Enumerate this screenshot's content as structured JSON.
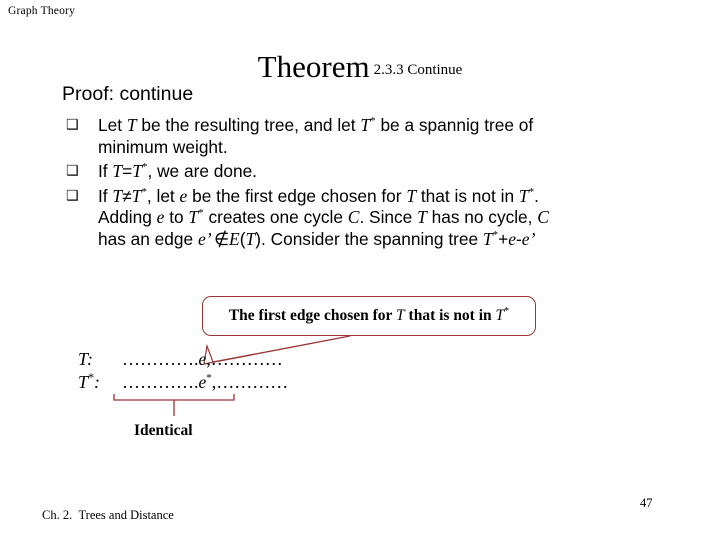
{
  "slide": {
    "header": "Graph Theory",
    "title": {
      "main": "Theorem",
      "sub": "2.3.3 Continue"
    },
    "proof_label": "Proof: continue",
    "bullet_glyph": "❑",
    "bullets": [
      {
        "id": "bullet-resulting-tree",
        "lines": [
          {
            "parts": [
              {
                "t": "text",
                "v": "Let "
              },
              {
                "t": "var",
                "v": "T"
              },
              {
                "t": "text",
                "v": " be the resulting tree, and let "
              },
              {
                "t": "var",
                "v": "T"
              },
              {
                "t": "sup",
                "v": "*"
              },
              {
                "t": "text",
                "v": " be a spannig tree of"
              }
            ]
          },
          {
            "parts": [
              {
                "t": "text",
                "v": "minimum weight."
              }
            ]
          }
        ]
      },
      {
        "id": "bullet-equal-case",
        "lines": [
          {
            "parts": [
              {
                "t": "text",
                "v": "If "
              },
              {
                "t": "var",
                "v": "T"
              },
              {
                "t": "varr",
                "v": "="
              },
              {
                "t": "var",
                "v": "T"
              },
              {
                "t": "sup",
                "v": "*"
              },
              {
                "t": "text",
                "v": ", we are done."
              }
            ]
          }
        ]
      },
      {
        "id": "bullet-not-equal-case",
        "lines": [
          {
            "parts": [
              {
                "t": "text",
                "v": "If "
              },
              {
                "t": "var",
                "v": "T"
              },
              {
                "t": "varr",
                "v": "≠"
              },
              {
                "t": "var",
                "v": "T"
              },
              {
                "t": "sup",
                "v": "*"
              },
              {
                "t": "text",
                "v": ", let "
              },
              {
                "t": "var",
                "v": "e"
              },
              {
                "t": "text",
                "v": " be the first edge chosen for "
              },
              {
                "t": "var",
                "v": "T"
              },
              {
                "t": "text",
                "v": " that is not in "
              },
              {
                "t": "var",
                "v": "T"
              },
              {
                "t": "sup",
                "v": "*"
              },
              {
                "t": "text",
                "v": "."
              }
            ]
          },
          {
            "parts": [
              {
                "t": "text",
                "v": "Adding "
              },
              {
                "t": "var",
                "v": "e"
              },
              {
                "t": "text",
                "v": " to "
              },
              {
                "t": "var",
                "v": "T"
              },
              {
                "t": "sup",
                "v": "*"
              },
              {
                "t": "text",
                "v": " creates one cycle "
              },
              {
                "t": "var",
                "v": "C"
              },
              {
                "t": "text",
                "v": ". Since "
              },
              {
                "t": "var",
                "v": "T"
              },
              {
                "t": "text",
                "v": " has no cycle, "
              },
              {
                "t": "var",
                "v": "C"
              }
            ]
          },
          {
            "parts": [
              {
                "t": "text",
                "v": "has an edge "
              },
              {
                "t": "var",
                "v": "e’ "
              },
              {
                "t": "varr",
                "v": "∉"
              },
              {
                "t": "var",
                "v": "E"
              },
              {
                "t": "varr",
                "v": "("
              },
              {
                "t": "var",
                "v": "T"
              },
              {
                "t": "varr",
                "v": ")"
              },
              {
                "t": "text",
                "v": ". Consider the spanning tree "
              },
              {
                "t": "var",
                "v": "T"
              },
              {
                "t": "sup",
                "v": "*"
              },
              {
                "t": "varr",
                "v": "+"
              },
              {
                "t": "var",
                "v": "e"
              },
              {
                "t": "varr",
                "v": "-"
              },
              {
                "t": "var",
                "v": "e’"
              }
            ]
          }
        ]
      }
    ],
    "callout": {
      "text_prefix": "The first edge chosen for ",
      "var_t": "T",
      "text_mid": " that is not in ",
      "var_t2": "T",
      "star": "*"
    },
    "sequences": [
      {
        "id": "seq-t",
        "label": "T:",
        "label_star": "",
        "dots_left": "………….",
        "edge": "e",
        "edge_star": "",
        "comma": ",",
        "dots_right": "…………"
      },
      {
        "id": "seq-t-star",
        "label": "T",
        "label_star": "*",
        "label_colon": ":",
        "dots_left": "………….",
        "edge": "e",
        "edge_star": "*",
        "comma": ",",
        "dots_right": "…………"
      }
    ],
    "identical_label": "Identical",
    "footer": {
      "chapter": "Ch. 2.",
      "chapter_title": "Trees and Distance",
      "page_number": "47"
    },
    "colors": {
      "accent_red": "#9a3334",
      "text": "#000000",
      "background": "#ffffff"
    }
  }
}
